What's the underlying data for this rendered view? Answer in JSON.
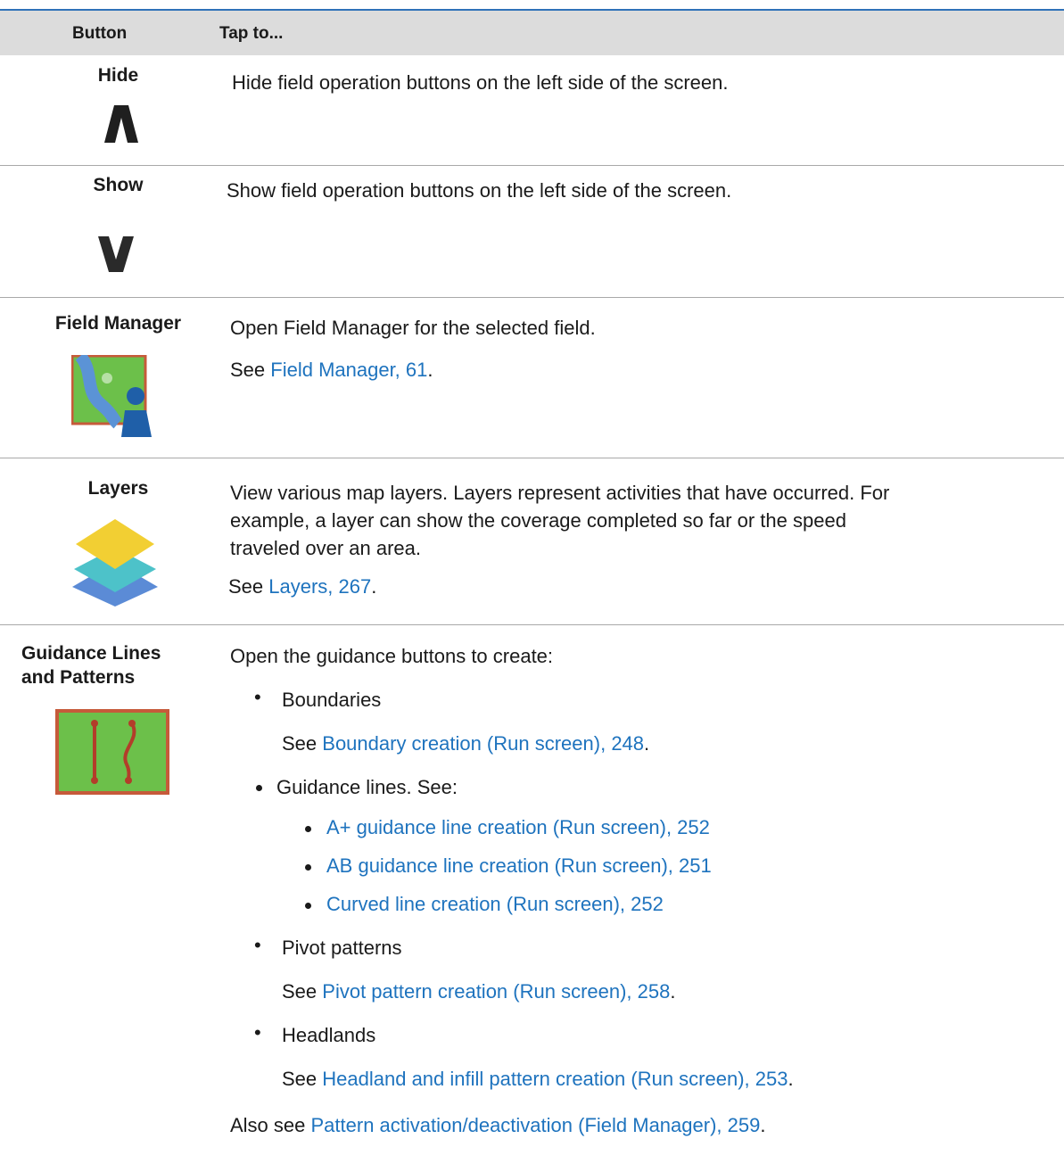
{
  "header": {
    "col1": "Button",
    "col2": "Tap to..."
  },
  "rows": {
    "hide": {
      "name": "Hide",
      "desc": "Hide field operation buttons on the left side of the screen."
    },
    "show": {
      "name": "Show",
      "desc": "Show field operation buttons on the left side of the screen."
    },
    "field_manager": {
      "name": "Field Manager",
      "desc": "Open Field Manager for the selected field.",
      "see_prefix": "See ",
      "see_link": "Field Manager, 61",
      "see_suffix": "."
    },
    "layers": {
      "name": "Layers",
      "desc_line1": "View various map layers. Layers represent activities that have occurred. For",
      "desc_line2": "example, a layer can show the coverage completed so far or the speed",
      "desc_line3": "traveled over an area.",
      "see_prefix": "See ",
      "see_link": "Layers, 267",
      "see_suffix": "."
    },
    "guidance": {
      "name_line1": "Guidance Lines",
      "name_line2": "and Patterns",
      "intro": "Open the guidance buttons to create:",
      "boundaries": "Boundaries",
      "boundaries_see_prefix": "See ",
      "boundaries_see_link": "Boundary creation (Run screen), 248",
      "boundaries_see_suffix": ".",
      "guidance_lines": "Guidance lines. See:",
      "sub_links": [
        "A+ guidance line creation (Run screen), 252",
        "AB guidance line creation (Run screen), 251",
        "Curved line creation (Run screen), 252"
      ],
      "pivot": "Pivot patterns",
      "pivot_see_prefix": "See ",
      "pivot_see_link": "Pivot pattern creation (Run screen), 258",
      "pivot_see_suffix": ".",
      "headlands": "Headlands",
      "headlands_see_prefix": "See ",
      "headlands_see_link": "Headland and infill pattern creation (Run screen), 253",
      "headlands_see_suffix": ".",
      "also_prefix": "Also see ",
      "also_link": "Pattern activation/deactivation (Field Manager), 259",
      "also_suffix": "."
    }
  },
  "colors": {
    "link": "#1e73be",
    "header_bg": "#dcdcdc",
    "rule_top": "#2f72b8"
  },
  "icons": [
    "chevron-up-icon",
    "chevron-down-icon",
    "field-manager-icon",
    "layers-icon",
    "guidance-lines-icon"
  ]
}
